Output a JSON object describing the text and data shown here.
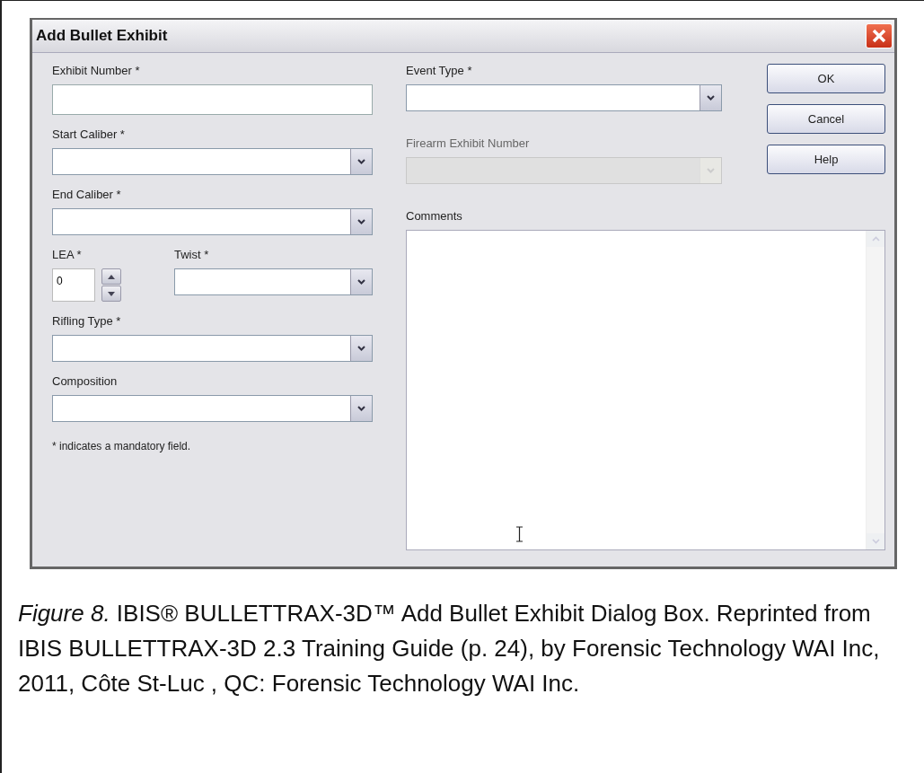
{
  "dialog": {
    "title": "Add Bullet Exhibit",
    "left_fields": [
      {
        "kind": "text",
        "label": "Exhibit Number *",
        "disabled": false
      },
      {
        "kind": "combo",
        "label": "Start Caliber *",
        "disabled": false
      },
      {
        "kind": "combo",
        "label": "End Caliber *",
        "disabled": false
      },
      {
        "kind": "pair",
        "items": [
          {
            "kind": "spin",
            "label": "LEA *",
            "value": "0",
            "disabled": false
          },
          {
            "kind": "combo",
            "label": "Twist *",
            "disabled": false
          }
        ]
      },
      {
        "kind": "combo",
        "label": "Rifling Type *",
        "disabled": false
      },
      {
        "kind": "combo",
        "label": "Composition",
        "disabled": false
      }
    ],
    "note": "* indicates a mandatory field.",
    "right_fields": [
      {
        "kind": "combo",
        "label": "Event Type *",
        "disabled": false
      },
      {
        "kind": "combo",
        "label": "Firearm Exhibit Number",
        "disabled": true
      }
    ],
    "comments_label": "Comments",
    "buttons": [
      "OK",
      "Cancel",
      "Help"
    ]
  },
  "caption": "*Figure 8.* IBIS® BULLETTRAX-3D™ Add Bullet Exhibit Dialog Box. Reprinted from IBIS BULLETTRAX-3D 2.3 Training Guide (p. 24), by Forensic Technology WAI Inc, 2011, Côte St-Luc , QC: Forensic Technology WAI Inc."
}
